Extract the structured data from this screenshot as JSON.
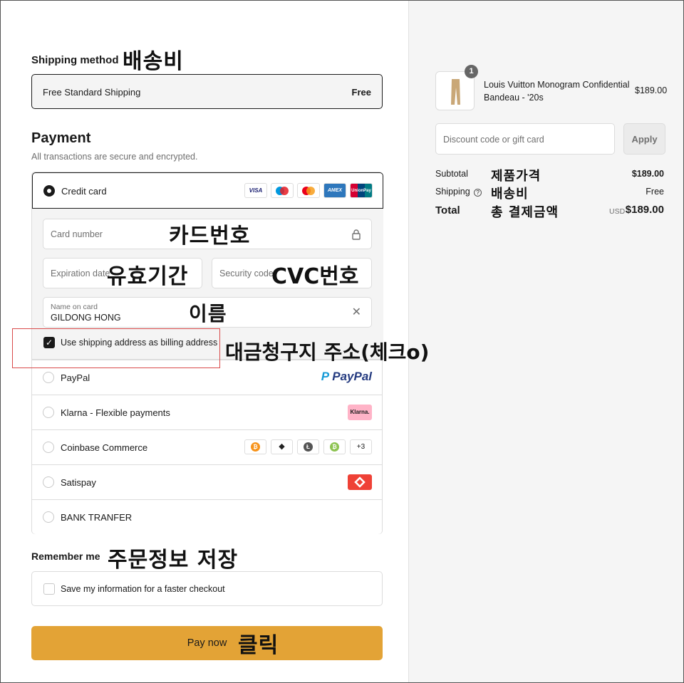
{
  "shipping": {
    "title": "Shipping method",
    "annotation": "배송비",
    "option_name": "Free Standard Shipping",
    "option_price": "Free"
  },
  "payment": {
    "title": "Payment",
    "subtitle": "All transactions are secure and encrypted.",
    "credit_card_label": "Credit card",
    "card_brands": [
      "VISA",
      "Maestro",
      "Mastercard",
      "AMEX",
      "UnionPay"
    ],
    "card_number_placeholder": "Card number",
    "card_number_annotation": "카드번호",
    "expiration_placeholder": "Expiration date",
    "expiration_annotation": "유효기간",
    "security_placeholder": "Security code",
    "security_annotation": "CVC번호",
    "name_label": "Name on card",
    "name_value": "GILDONG HONG",
    "name_annotation": "이름",
    "billing_checkbox_label": "Use shipping address as billing address",
    "billing_checked": true,
    "billing_annotation": "대금청구지 주소(체크o)",
    "options": [
      {
        "label": "PayPal",
        "logo": "PayPal"
      },
      {
        "label": "Klarna - Flexible payments",
        "logo": "Klarna."
      },
      {
        "label": "Coinbase Commerce",
        "logo": "+3"
      },
      {
        "label": "Satispay",
        "logo": "satispay-icon"
      },
      {
        "label": "BANK TRANFER",
        "logo": ""
      }
    ]
  },
  "remember": {
    "title": "Remember me",
    "annotation": "주문정보 저장",
    "checkbox_label": "Save my information for a faster checkout"
  },
  "pay_button": {
    "label": "Pay now",
    "annotation": "클릭"
  },
  "order": {
    "quantity": "1",
    "product_name": "Louis Vuitton Monogram Confidential Bandeau - '20s",
    "product_price": "$189.00",
    "discount_placeholder": "Discount code or gift card",
    "apply_label": "Apply",
    "subtotal_label": "Subtotal",
    "subtotal_annotation": "제품가격",
    "subtotal_value": "$189.00",
    "shipping_label": "Shipping",
    "shipping_annotation": "배송비",
    "shipping_value": "Free",
    "total_label": "Total",
    "total_annotation": "총 결제금액",
    "currency": "USD",
    "total_value": "$189.00"
  },
  "colors": {
    "pay_button": "#e3a336",
    "annotation_box": "#d94a4a",
    "right_panel_bg": "#f5f5f5"
  }
}
